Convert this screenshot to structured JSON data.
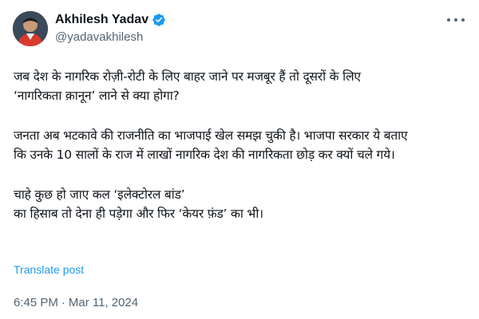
{
  "author": {
    "display_name": "Akhilesh Yadav",
    "handle": "@yadavakhilesh",
    "verified": true,
    "verified_color": "#1d9bf0",
    "avatar_icon": "profile-photo"
  },
  "tweet": {
    "paragraphs": [
      {
        "lines": [
          "जब देश के नागरिक रोज़ी-रोटी के लिए बाहर जाने पर मजबूर हैं तो दूसरों के लिए",
          "‘नागरिकता क़ानून’ लाने से क्या होगा?"
        ]
      },
      {
        "lines": [
          "जनता अब भटकावे की राजनीति का भाजपाई खेल समझ चुकी है। भाजपा सरकार ये बताए",
          "कि उनके 10 सालों के राज में लाखों नागरिक देश की नागरिकता छोड़ कर क्यों चले गये।"
        ]
      },
      {
        "lines": [
          "चाहे कुछ हो जाए कल ‘इलेक्टोरल बांड’",
          "का हिसाब तो देना ही पड़ेगा और फिर ‘केयर फ़ंड’ का भी।"
        ]
      }
    ],
    "translate_label": "Translate post",
    "time": "6:45 PM",
    "separator": "·",
    "date": "Mar 11, 2024"
  },
  "colors": {
    "text_primary": "#0f1419",
    "text_secondary": "#536471",
    "link": "#1d9bf0"
  }
}
